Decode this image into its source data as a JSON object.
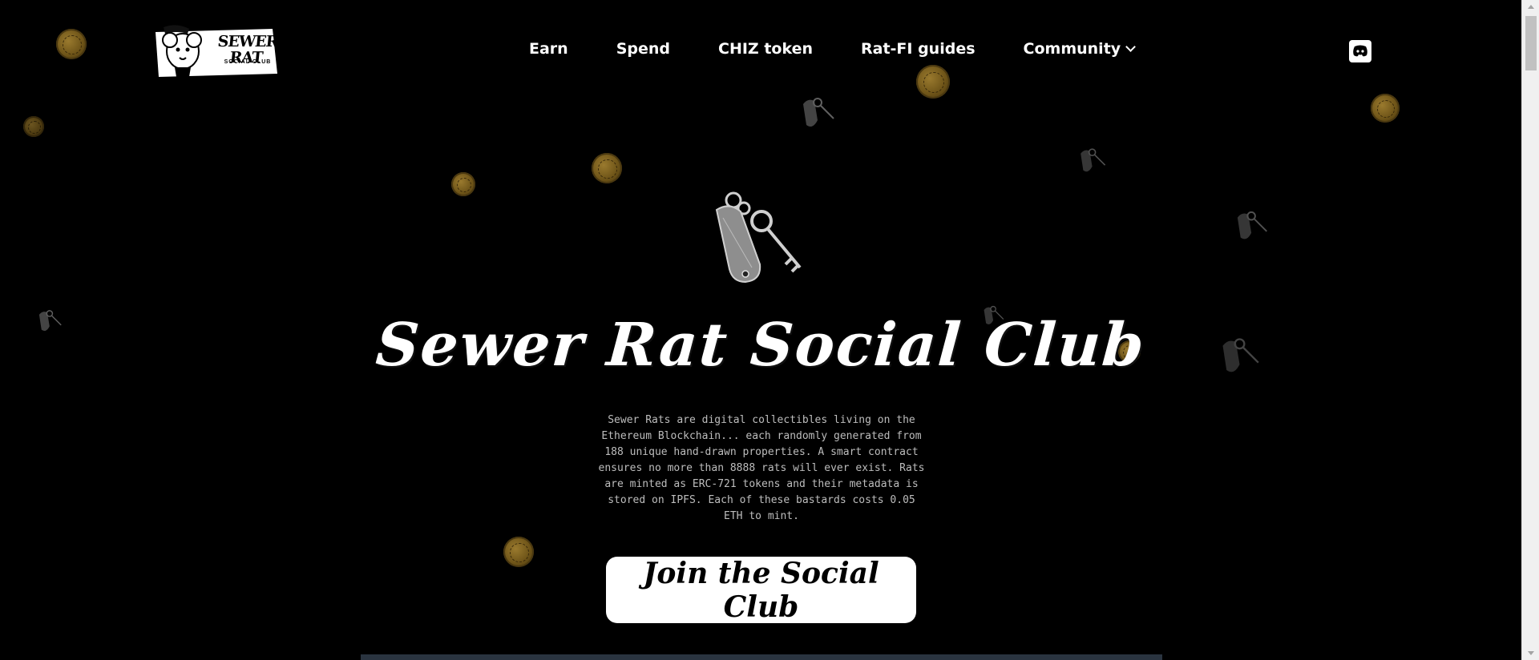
{
  "nav": {
    "logo": {
      "title": "SEWER RAT",
      "subtitle": "SOCIAL CLUB"
    },
    "items": [
      {
        "label": "Earn"
      },
      {
        "label": "Spend"
      },
      {
        "label": "CHIZ token"
      },
      {
        "label": "Rat-FI guides"
      },
      {
        "label": "Community",
        "icon": "chevron-down-icon"
      }
    ],
    "discord_icon": "discord-icon"
  },
  "hero": {
    "title": "Sewer Rat Social Club",
    "description": "Sewer Rats are digital collectibles living on the Ethereum Blockchain... each randomly generated from 188 unique hand-drawn properties. A smart contract ensures no more than 8888 rats will ever exist. Rats are minted as ERC-721 tokens and their metadata is stored on IPFS. Each of these bastards costs 0.05 ETH to mint.",
    "cta_label": "Join the Social Club",
    "key_icon": "motel-key-icon"
  },
  "colors": {
    "background": "#000000",
    "text": "#ffffff",
    "description_text": "#bdbdbd",
    "coin": "#7a5c1c",
    "button_bg": "#ffffff"
  }
}
